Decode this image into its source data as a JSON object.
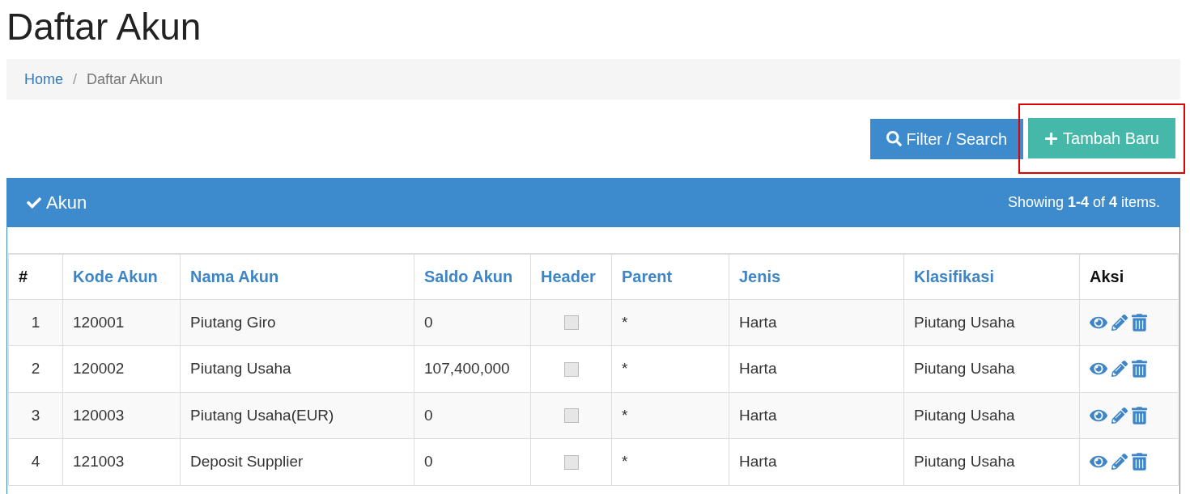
{
  "page_title": "Daftar Akun",
  "breadcrumb_separator": "/",
  "breadcrumb": [
    {
      "label": "Home",
      "kind": "link"
    },
    {
      "label": "Daftar Akun",
      "kind": "current"
    }
  ],
  "buttons": [
    {
      "label": "Filter / Search",
      "kind": "filter",
      "highlighted": false
    },
    {
      "label": "Tambah Baru",
      "kind": "add",
      "highlighted": true
    }
  ],
  "panel": {
    "title": "Akun",
    "summary": "Showing **1-4** of **4** items."
  },
  "table": {
    "columns": [
      {
        "label": "#",
        "sortable": false
      },
      {
        "label": "Kode Akun",
        "sortable": true
      },
      {
        "label": "Nama Akun",
        "sortable": true
      },
      {
        "label": "Saldo Akun",
        "sortable": true
      },
      {
        "label": "Header",
        "sortable": true
      },
      {
        "label": "Parent",
        "sortable": true
      },
      {
        "label": "Jenis",
        "sortable": true
      },
      {
        "label": "Klasifikasi",
        "sortable": true
      },
      {
        "label": "Aksi",
        "sortable": false
      }
    ],
    "rows": [
      {
        "no": "1",
        "kode": "120001",
        "nama": "Piutang Giro",
        "saldo": "0",
        "header": false,
        "parent": "*",
        "jenis": "Harta",
        "klasifikasi": "Piutang Usaha"
      },
      {
        "no": "2",
        "kode": "120002",
        "nama": "Piutang Usaha",
        "saldo": "107,400,000",
        "header": false,
        "parent": "*",
        "jenis": "Harta",
        "klasifikasi": "Piutang Usaha"
      },
      {
        "no": "3",
        "kode": "120003",
        "nama": "Piutang Usaha(EUR)",
        "saldo": "0",
        "header": false,
        "parent": "*",
        "jenis": "Harta",
        "klasifikasi": "Piutang Usaha"
      },
      {
        "no": "4",
        "kode": "121003",
        "nama": "Deposit Supplier",
        "saldo": "0",
        "header": false,
        "parent": "*",
        "jenis": "Harta",
        "klasifikasi": "Piutang Usaha"
      }
    ]
  }
}
